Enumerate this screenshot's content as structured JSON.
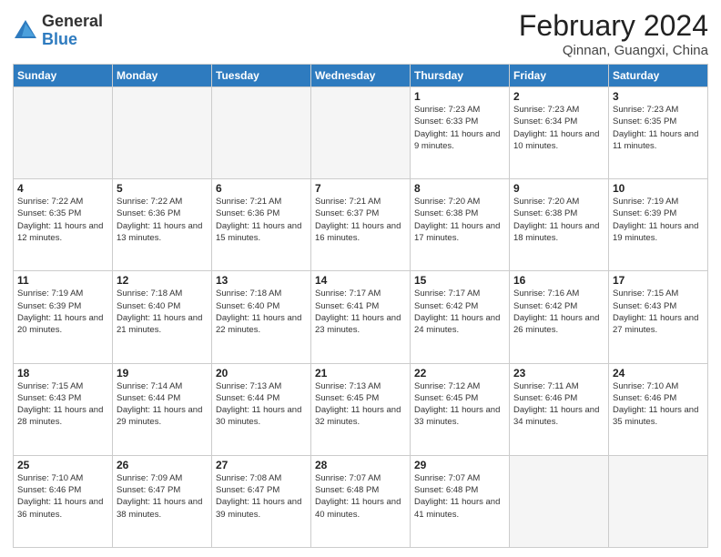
{
  "header": {
    "logo_general": "General",
    "logo_blue": "Blue",
    "title": "February 2024",
    "location": "Qinnan, Guangxi, China"
  },
  "weekdays": [
    "Sunday",
    "Monday",
    "Tuesday",
    "Wednesday",
    "Thursday",
    "Friday",
    "Saturday"
  ],
  "weeks": [
    [
      {
        "day": "",
        "sunrise": "",
        "sunset": "",
        "daylight": "",
        "empty": true
      },
      {
        "day": "",
        "sunrise": "",
        "sunset": "",
        "daylight": "",
        "empty": true
      },
      {
        "day": "",
        "sunrise": "",
        "sunset": "",
        "daylight": "",
        "empty": true
      },
      {
        "day": "",
        "sunrise": "",
        "sunset": "",
        "daylight": "",
        "empty": true
      },
      {
        "day": "1",
        "sunrise": "Sunrise: 7:23 AM",
        "sunset": "Sunset: 6:33 PM",
        "daylight": "Daylight: 11 hours and 9 minutes.",
        "empty": false
      },
      {
        "day": "2",
        "sunrise": "Sunrise: 7:23 AM",
        "sunset": "Sunset: 6:34 PM",
        "daylight": "Daylight: 11 hours and 10 minutes.",
        "empty": false
      },
      {
        "day": "3",
        "sunrise": "Sunrise: 7:23 AM",
        "sunset": "Sunset: 6:35 PM",
        "daylight": "Daylight: 11 hours and 11 minutes.",
        "empty": false
      }
    ],
    [
      {
        "day": "4",
        "sunrise": "Sunrise: 7:22 AM",
        "sunset": "Sunset: 6:35 PM",
        "daylight": "Daylight: 11 hours and 12 minutes.",
        "empty": false
      },
      {
        "day": "5",
        "sunrise": "Sunrise: 7:22 AM",
        "sunset": "Sunset: 6:36 PM",
        "daylight": "Daylight: 11 hours and 13 minutes.",
        "empty": false
      },
      {
        "day": "6",
        "sunrise": "Sunrise: 7:21 AM",
        "sunset": "Sunset: 6:36 PM",
        "daylight": "Daylight: 11 hours and 15 minutes.",
        "empty": false
      },
      {
        "day": "7",
        "sunrise": "Sunrise: 7:21 AM",
        "sunset": "Sunset: 6:37 PM",
        "daylight": "Daylight: 11 hours and 16 minutes.",
        "empty": false
      },
      {
        "day": "8",
        "sunrise": "Sunrise: 7:20 AM",
        "sunset": "Sunset: 6:38 PM",
        "daylight": "Daylight: 11 hours and 17 minutes.",
        "empty": false
      },
      {
        "day": "9",
        "sunrise": "Sunrise: 7:20 AM",
        "sunset": "Sunset: 6:38 PM",
        "daylight": "Daylight: 11 hours and 18 minutes.",
        "empty": false
      },
      {
        "day": "10",
        "sunrise": "Sunrise: 7:19 AM",
        "sunset": "Sunset: 6:39 PM",
        "daylight": "Daylight: 11 hours and 19 minutes.",
        "empty": false
      }
    ],
    [
      {
        "day": "11",
        "sunrise": "Sunrise: 7:19 AM",
        "sunset": "Sunset: 6:39 PM",
        "daylight": "Daylight: 11 hours and 20 minutes.",
        "empty": false
      },
      {
        "day": "12",
        "sunrise": "Sunrise: 7:18 AM",
        "sunset": "Sunset: 6:40 PM",
        "daylight": "Daylight: 11 hours and 21 minutes.",
        "empty": false
      },
      {
        "day": "13",
        "sunrise": "Sunrise: 7:18 AM",
        "sunset": "Sunset: 6:40 PM",
        "daylight": "Daylight: 11 hours and 22 minutes.",
        "empty": false
      },
      {
        "day": "14",
        "sunrise": "Sunrise: 7:17 AM",
        "sunset": "Sunset: 6:41 PM",
        "daylight": "Daylight: 11 hours and 23 minutes.",
        "empty": false
      },
      {
        "day": "15",
        "sunrise": "Sunrise: 7:17 AM",
        "sunset": "Sunset: 6:42 PM",
        "daylight": "Daylight: 11 hours and 24 minutes.",
        "empty": false
      },
      {
        "day": "16",
        "sunrise": "Sunrise: 7:16 AM",
        "sunset": "Sunset: 6:42 PM",
        "daylight": "Daylight: 11 hours and 26 minutes.",
        "empty": false
      },
      {
        "day": "17",
        "sunrise": "Sunrise: 7:15 AM",
        "sunset": "Sunset: 6:43 PM",
        "daylight": "Daylight: 11 hours and 27 minutes.",
        "empty": false
      }
    ],
    [
      {
        "day": "18",
        "sunrise": "Sunrise: 7:15 AM",
        "sunset": "Sunset: 6:43 PM",
        "daylight": "Daylight: 11 hours and 28 minutes.",
        "empty": false
      },
      {
        "day": "19",
        "sunrise": "Sunrise: 7:14 AM",
        "sunset": "Sunset: 6:44 PM",
        "daylight": "Daylight: 11 hours and 29 minutes.",
        "empty": false
      },
      {
        "day": "20",
        "sunrise": "Sunrise: 7:13 AM",
        "sunset": "Sunset: 6:44 PM",
        "daylight": "Daylight: 11 hours and 30 minutes.",
        "empty": false
      },
      {
        "day": "21",
        "sunrise": "Sunrise: 7:13 AM",
        "sunset": "Sunset: 6:45 PM",
        "daylight": "Daylight: 11 hours and 32 minutes.",
        "empty": false
      },
      {
        "day": "22",
        "sunrise": "Sunrise: 7:12 AM",
        "sunset": "Sunset: 6:45 PM",
        "daylight": "Daylight: 11 hours and 33 minutes.",
        "empty": false
      },
      {
        "day": "23",
        "sunrise": "Sunrise: 7:11 AM",
        "sunset": "Sunset: 6:46 PM",
        "daylight": "Daylight: 11 hours and 34 minutes.",
        "empty": false
      },
      {
        "day": "24",
        "sunrise": "Sunrise: 7:10 AM",
        "sunset": "Sunset: 6:46 PM",
        "daylight": "Daylight: 11 hours and 35 minutes.",
        "empty": false
      }
    ],
    [
      {
        "day": "25",
        "sunrise": "Sunrise: 7:10 AM",
        "sunset": "Sunset: 6:46 PM",
        "daylight": "Daylight: 11 hours and 36 minutes.",
        "empty": false
      },
      {
        "day": "26",
        "sunrise": "Sunrise: 7:09 AM",
        "sunset": "Sunset: 6:47 PM",
        "daylight": "Daylight: 11 hours and 38 minutes.",
        "empty": false
      },
      {
        "day": "27",
        "sunrise": "Sunrise: 7:08 AM",
        "sunset": "Sunset: 6:47 PM",
        "daylight": "Daylight: 11 hours and 39 minutes.",
        "empty": false
      },
      {
        "day": "28",
        "sunrise": "Sunrise: 7:07 AM",
        "sunset": "Sunset: 6:48 PM",
        "daylight": "Daylight: 11 hours and 40 minutes.",
        "empty": false
      },
      {
        "day": "29",
        "sunrise": "Sunrise: 7:07 AM",
        "sunset": "Sunset: 6:48 PM",
        "daylight": "Daylight: 11 hours and 41 minutes.",
        "empty": false
      },
      {
        "day": "",
        "sunrise": "",
        "sunset": "",
        "daylight": "",
        "empty": true
      },
      {
        "day": "",
        "sunrise": "",
        "sunset": "",
        "daylight": "",
        "empty": true
      }
    ]
  ]
}
